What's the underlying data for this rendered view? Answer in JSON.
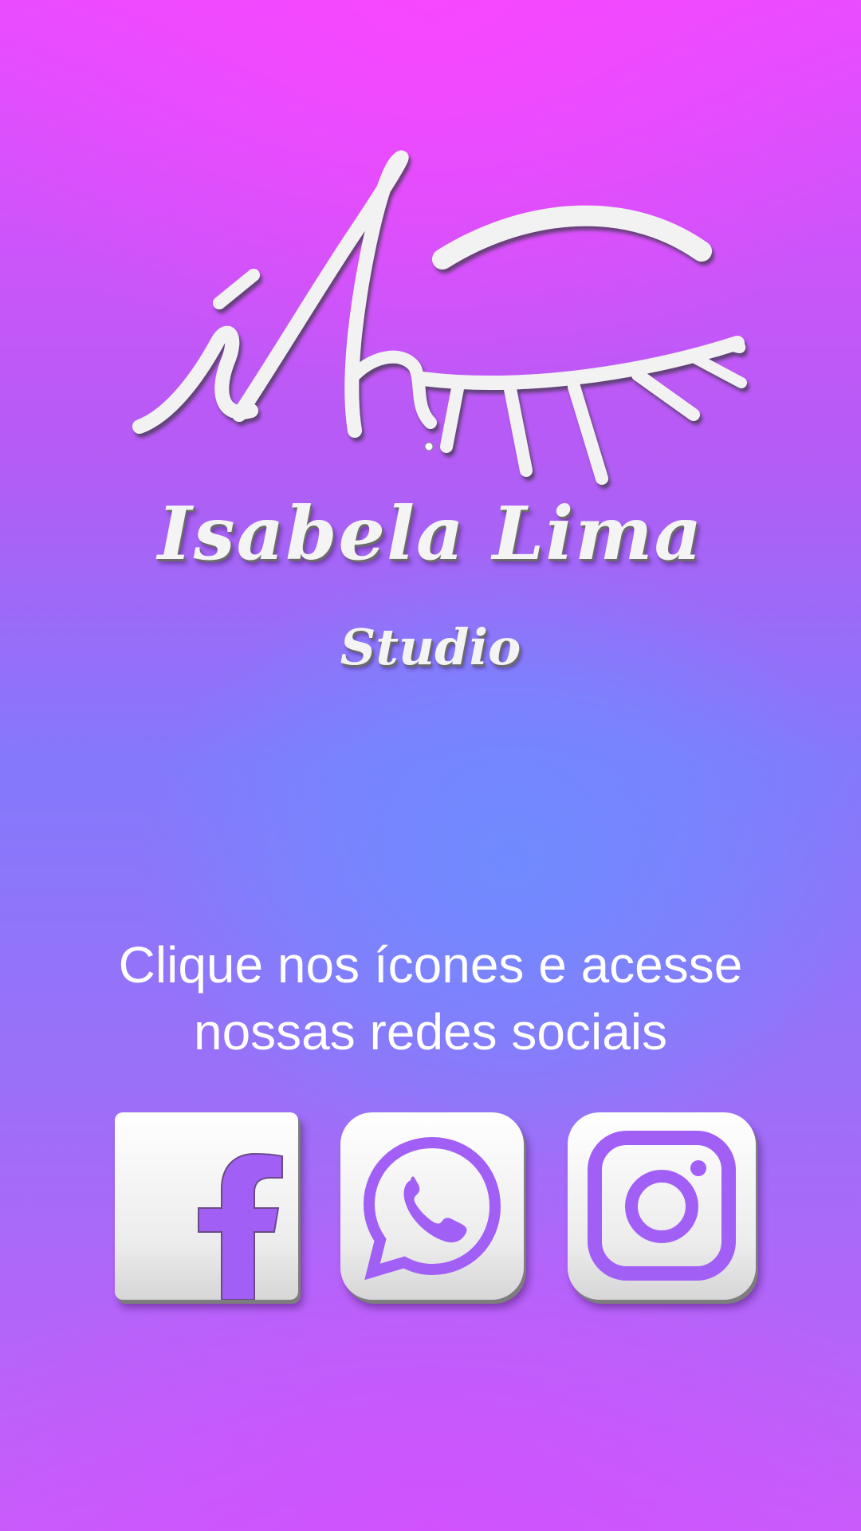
{
  "logo": {
    "monogram_icon": "ih-monogram-eyelash-icon",
    "brand_name": "Isabela Lima",
    "brand_subtitle": "Studio"
  },
  "cta": {
    "line1": "Clique nos ícones e acesse",
    "line2": "nossas redes sociais"
  },
  "social": {
    "facebook": {
      "icon": "facebook-icon"
    },
    "whatsapp": {
      "icon": "whatsapp-icon"
    },
    "instagram": {
      "icon": "instagram-icon"
    }
  },
  "colors": {
    "background_top": "#e84cff",
    "background_center": "#6e8cff",
    "background_bottom": "#c85cfa",
    "foreground": "#ffffff",
    "emboss_shadow": "#6b6b6b"
  }
}
